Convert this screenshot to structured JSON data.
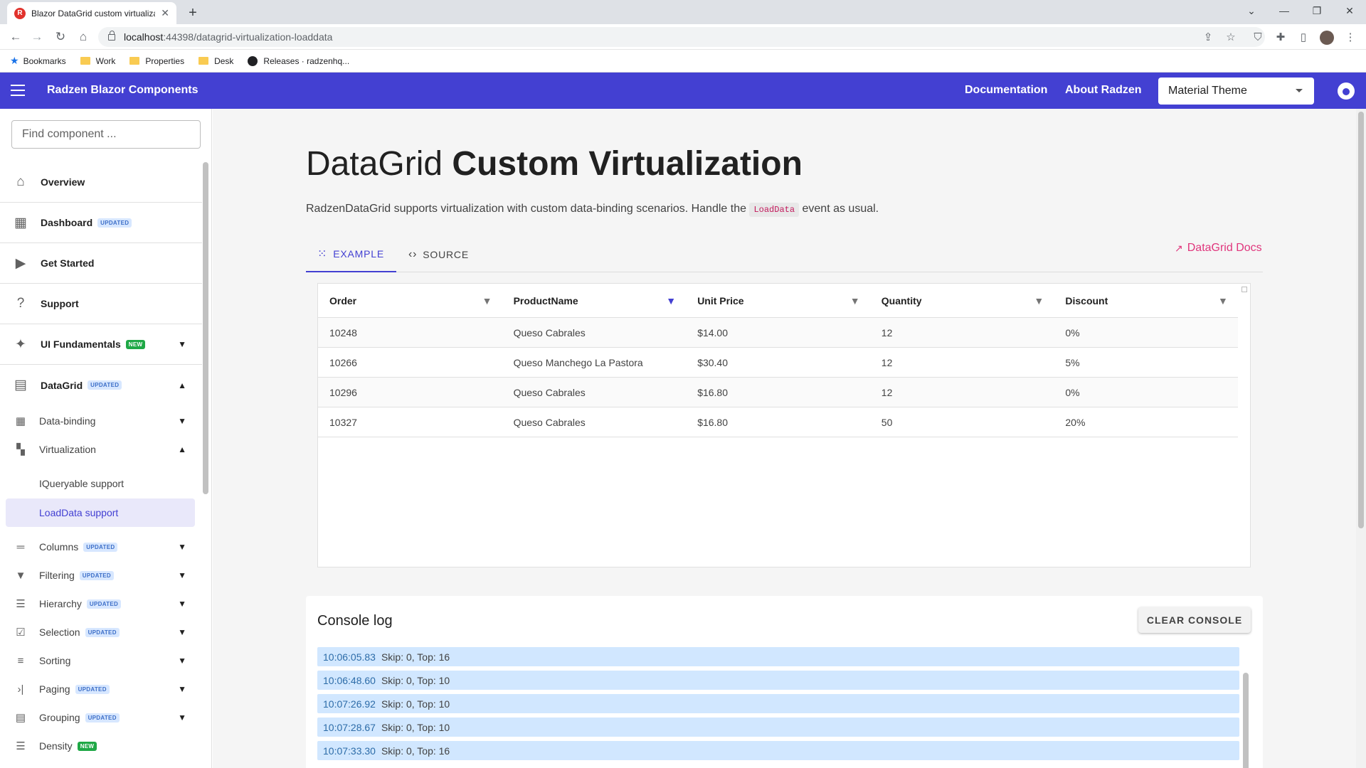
{
  "browser": {
    "tab_title": "Blazor DataGrid custom virtualiza",
    "url_host": "localhost",
    "url_path": ":44398/datagrid-virtualization-loaddata",
    "bookmarks": [
      {
        "label": "Bookmarks",
        "icon": "star-icon"
      },
      {
        "label": "Work",
        "icon": "folder-icon"
      },
      {
        "label": "Properties",
        "icon": "folder-icon"
      },
      {
        "label": "Desk",
        "icon": "folder-icon"
      },
      {
        "label": "Releases · radzenhq...",
        "icon": "github-icon"
      }
    ]
  },
  "header": {
    "title": "Radzen Blazor Components",
    "links": [
      "Documentation",
      "About Radzen"
    ],
    "theme": "Material Theme",
    "accent": "#4340d2"
  },
  "sidebar": {
    "search_placeholder": "Find component ...",
    "top_items": [
      {
        "label": "Overview",
        "icon": "home-icon"
      },
      {
        "label": "Dashboard",
        "icon": "dashboard-icon",
        "badge": "UPDATED"
      },
      {
        "label": "Get Started",
        "icon": "play-icon"
      },
      {
        "label": "Support",
        "icon": "help-icon"
      },
      {
        "label": "UI Fundamentals",
        "icon": "fundamentals-icon",
        "badge": "NEW"
      },
      {
        "label": "DataGrid",
        "icon": "datagrid-icon",
        "badge": "UPDATED"
      }
    ],
    "sub_items": [
      {
        "label": "Data-binding",
        "icon": "grid-icon"
      },
      {
        "label": "Virtualization",
        "icon": "virtualization-icon"
      }
    ],
    "leaves": [
      {
        "label": "IQueryable support"
      },
      {
        "label": "LoadData support"
      }
    ],
    "more_items": [
      {
        "label": "Columns",
        "icon": "columns-icon",
        "badge": "UPDATED"
      },
      {
        "label": "Filtering",
        "icon": "filter-icon",
        "badge": "UPDATED"
      },
      {
        "label": "Hierarchy",
        "icon": "hierarchy-icon",
        "badge": "UPDATED"
      },
      {
        "label": "Selection",
        "icon": "selection-icon",
        "badge": "UPDATED"
      },
      {
        "label": "Sorting",
        "icon": "sort-icon"
      },
      {
        "label": "Paging",
        "icon": "paging-icon",
        "badge": "UPDATED"
      },
      {
        "label": "Grouping",
        "icon": "grouping-icon",
        "badge": "UPDATED"
      },
      {
        "label": "Density",
        "icon": "density-icon",
        "badge": "NEW"
      }
    ]
  },
  "main": {
    "title_light": "DataGrid ",
    "title_bold": "Custom Virtualization",
    "desc_before": "RadzenDataGrid supports virtualization with custom data-binding scenarios. Handle the ",
    "desc_code": "LoadData",
    "desc_after": " event as usual.",
    "tabs": [
      {
        "label": "EXAMPLE"
      },
      {
        "label": "SOURCE"
      }
    ],
    "docs_link": "DataGrid Docs"
  },
  "grid": {
    "columns": [
      "Order",
      "ProductName",
      "Unit Price",
      "Quantity",
      "Discount"
    ],
    "active_filter_column": "ProductName",
    "rows": [
      [
        "10248",
        "Queso Cabrales",
        "$14.00",
        "12",
        "0%"
      ],
      [
        "10266",
        "Queso Manchego La Pastora",
        "$30.40",
        "12",
        "5%"
      ],
      [
        "10296",
        "Queso Cabrales",
        "$16.80",
        "12",
        "0%"
      ],
      [
        "10327",
        "Queso Cabrales",
        "$16.80",
        "50",
        "20%"
      ]
    ]
  },
  "console": {
    "title": "Console log",
    "clear_label": "CLEAR CONSOLE",
    "entries": [
      {
        "time": "10:06:05.83",
        "msg": "Skip: 0, Top: 16"
      },
      {
        "time": "10:06:48.60",
        "msg": "Skip: 0, Top: 10"
      },
      {
        "time": "10:07:26.92",
        "msg": "Skip: 0, Top: 10"
      },
      {
        "time": "10:07:28.67",
        "msg": "Skip: 0, Top: 10"
      },
      {
        "time": "10:07:33.30",
        "msg": "Skip: 0, Top: 16"
      }
    ]
  }
}
